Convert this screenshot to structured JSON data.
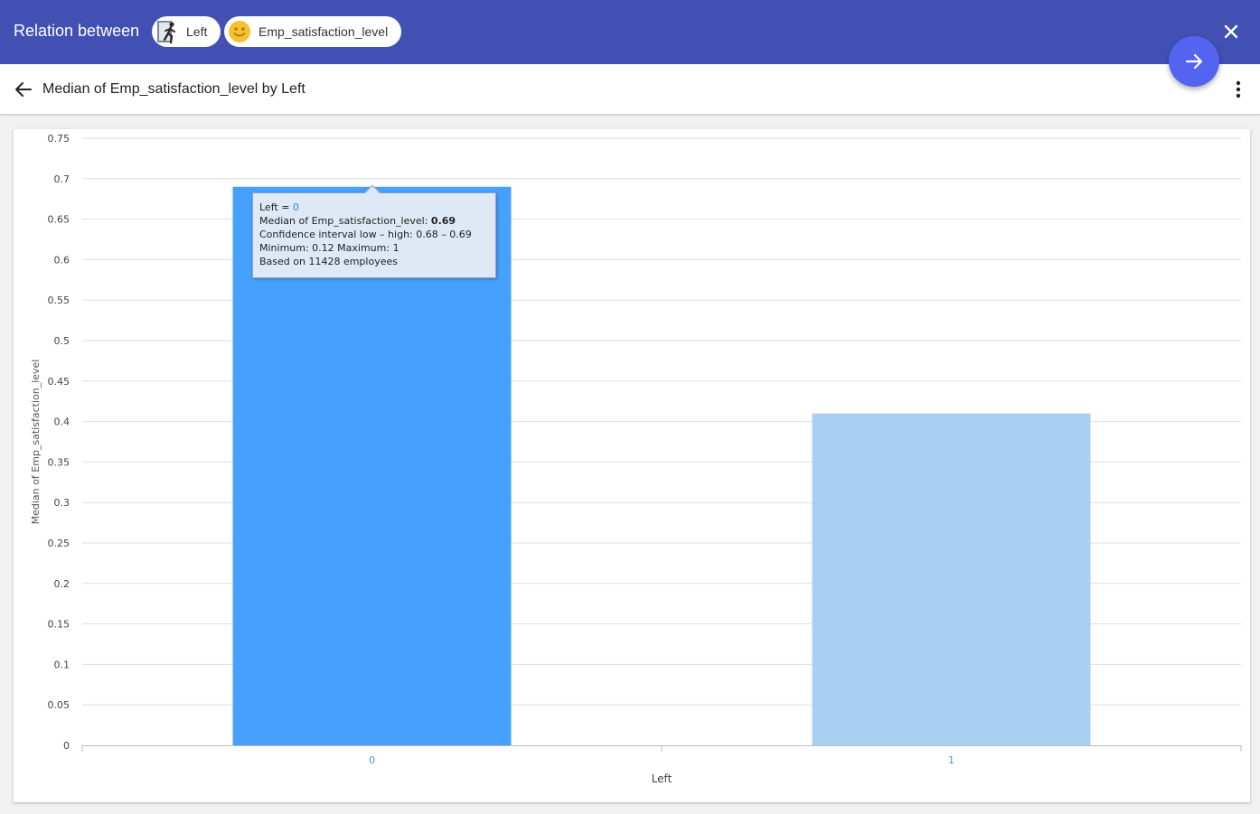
{
  "header": {
    "title": "Relation between",
    "chips": [
      {
        "label": "Left",
        "icon": "person-leaving-icon"
      },
      {
        "label": "Emp_satisfaction_level",
        "icon": "smiley-face-icon"
      }
    ]
  },
  "subheader": {
    "title": "Median of Emp_satisfaction_level by Left"
  },
  "tooltip": {
    "left_key": "Left = ",
    "left_value": "0",
    "median_key": "Median of Emp_satisfaction_level: ",
    "median_value": "0.69",
    "ci": "Confidence interval low – high: 0.68 – 0.69",
    "minmax": "Minimum: 0.12 Maximum: 1",
    "based_on": "Based on 11428 employees"
  },
  "colors": {
    "header": "#4250b3",
    "fab": "#5463f0",
    "bar_selected": "#45a1fd",
    "bar_other": "#a9cff3"
  },
  "chart_data": {
    "type": "bar",
    "categories": [
      "0",
      "1"
    ],
    "values": [
      0.69,
      0.41
    ],
    "xlabel": "Left",
    "ylabel": "Median of Emp_satisfaction_level",
    "ylim": [
      0,
      0.75
    ],
    "yticks": [
      "0",
      "0.05",
      "0.1",
      "0.15",
      "0.2",
      "0.25",
      "0.3",
      "0.35",
      "0.4",
      "0.45",
      "0.5",
      "0.55",
      "0.6",
      "0.65",
      "0.7",
      "0.75"
    ],
    "grid": true,
    "legend": "none"
  }
}
